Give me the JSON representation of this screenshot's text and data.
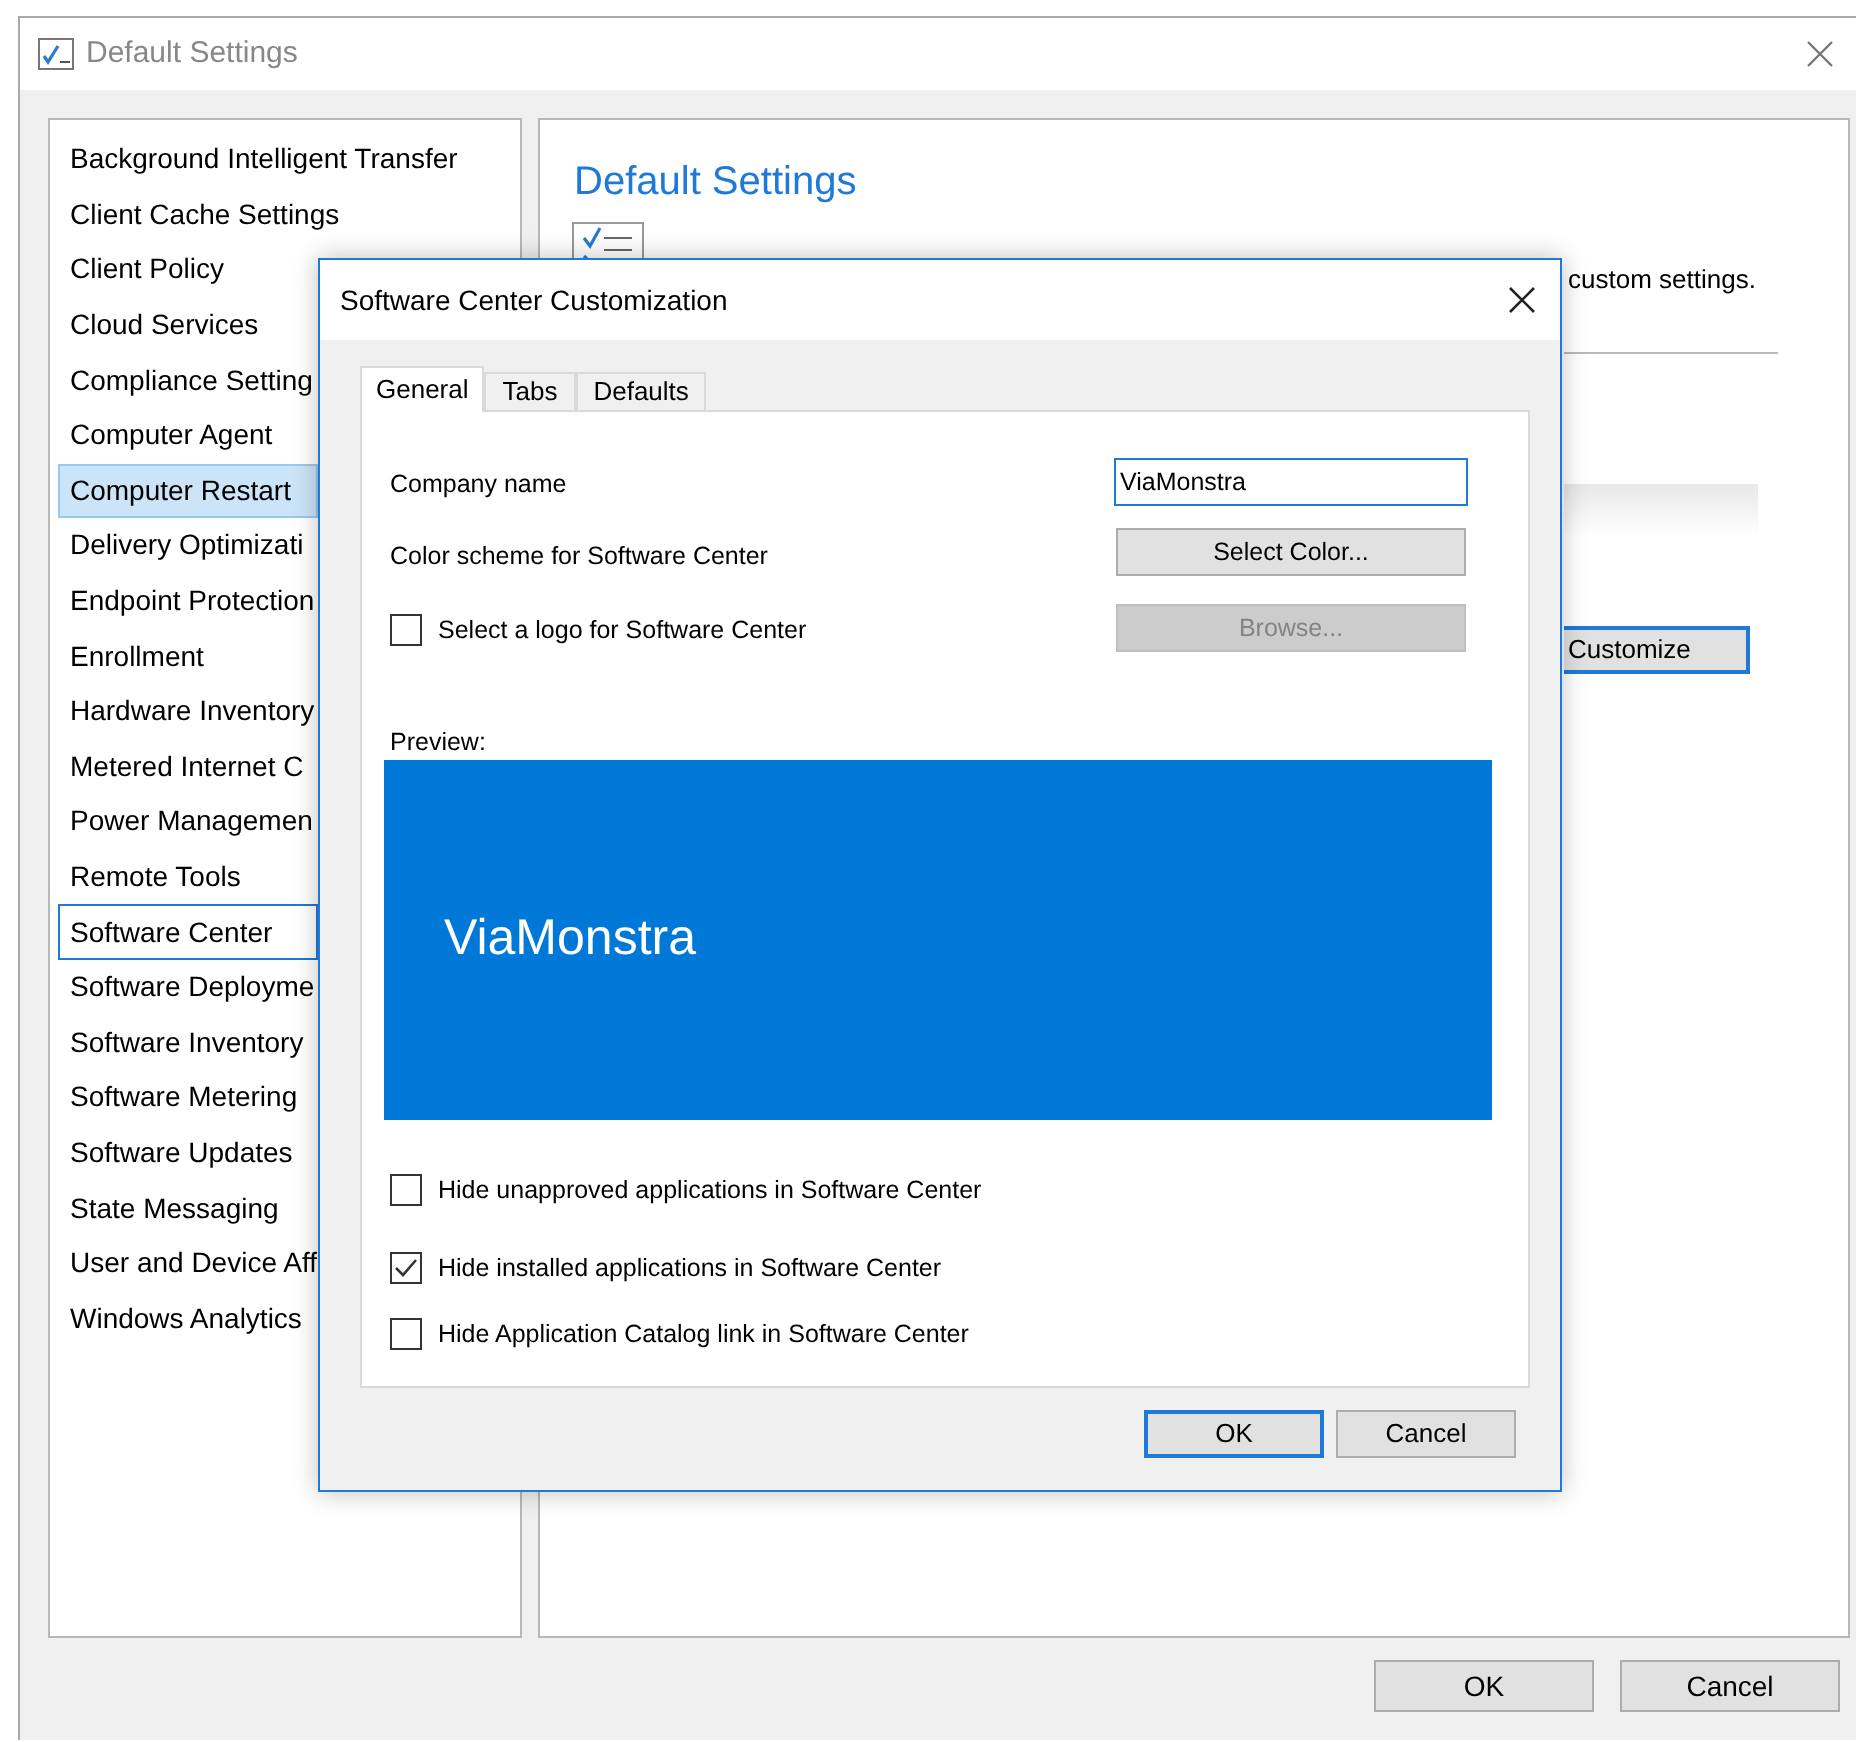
{
  "window": {
    "title": "Default Settings",
    "buttons": [
      {
        "label": "OK"
      },
      {
        "label": "Cancel"
      }
    ]
  },
  "sidebar": {
    "items": [
      {
        "label": "Background Intelligent Transfer",
        "selected": false,
        "focused": false
      },
      {
        "label": "Client Cache Settings",
        "selected": false,
        "focused": false
      },
      {
        "label": "Client Policy",
        "selected": false,
        "focused": false
      },
      {
        "label": "Cloud Services",
        "selected": false,
        "focused": false
      },
      {
        "label": "Compliance Setting",
        "selected": false,
        "focused": false
      },
      {
        "label": "Computer Agent",
        "selected": false,
        "focused": false
      },
      {
        "label": "Computer Restart",
        "selected": true,
        "focused": false
      },
      {
        "label": "Delivery Optimizati",
        "selected": false,
        "focused": false
      },
      {
        "label": "Endpoint Protection",
        "selected": false,
        "focused": false
      },
      {
        "label": "Enrollment",
        "selected": false,
        "focused": false
      },
      {
        "label": "Hardware Inventory",
        "selected": false,
        "focused": false
      },
      {
        "label": "Metered Internet C",
        "selected": false,
        "focused": false
      },
      {
        "label": "Power Managemen",
        "selected": false,
        "focused": false
      },
      {
        "label": "Remote Tools",
        "selected": false,
        "focused": false
      },
      {
        "label": "Software Center",
        "selected": false,
        "focused": true
      },
      {
        "label": "Software Deployme",
        "selected": false,
        "focused": false
      },
      {
        "label": "Software Inventory",
        "selected": false,
        "focused": false
      },
      {
        "label": "Software Metering",
        "selected": false,
        "focused": false
      },
      {
        "label": "Software Updates",
        "selected": false,
        "focused": false
      },
      {
        "label": "State Messaging",
        "selected": false,
        "focused": false
      },
      {
        "label": "User and Device Aff",
        "selected": false,
        "focused": false
      },
      {
        "label": "Windows Analytics",
        "selected": false,
        "focused": false
      }
    ]
  },
  "main": {
    "heading": "Default Settings",
    "description": "custom settings.",
    "customize_button": "Customize"
  },
  "dialog": {
    "title": "Software Center Customization",
    "tabs": [
      {
        "label": "General",
        "selected": true
      },
      {
        "label": "Tabs",
        "selected": false
      },
      {
        "label": "Defaults",
        "selected": false
      }
    ],
    "company_name": {
      "label": "Company name",
      "value": "ViaMonstra"
    },
    "color_scheme": {
      "label": "Color scheme for Software Center",
      "button": "Select Color..."
    },
    "logo": {
      "label": "Select a logo for Software Center",
      "checked": false,
      "button": "Browse...",
      "button_disabled": true
    },
    "preview": {
      "label": "Preview:",
      "color": "#0078d7",
      "text": "ViaMonstra"
    },
    "options": [
      {
        "label": "Hide unapproved applications in Software Center",
        "checked": false
      },
      {
        "label": "Hide installed applications in Software Center",
        "checked": true
      },
      {
        "label": "Hide Application Catalog link in Software Center",
        "checked": false
      }
    ],
    "buttons": [
      {
        "label": "OK",
        "default": true
      },
      {
        "label": "Cancel",
        "default": false
      }
    ]
  }
}
